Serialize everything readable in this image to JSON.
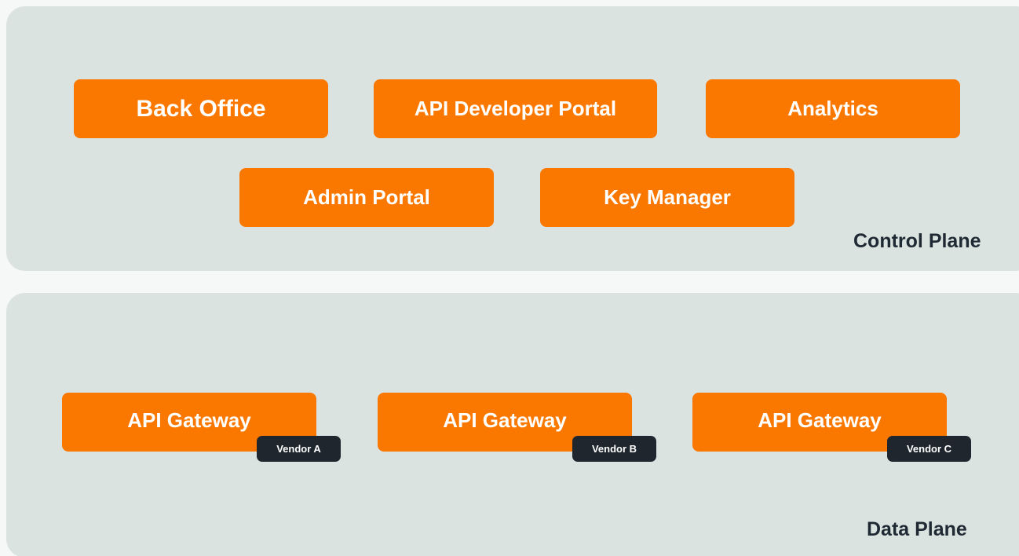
{
  "control_plane": {
    "label": "Control Plane",
    "components": {
      "back_office": "Back Office",
      "api_developer_portal": "API Developer Portal",
      "analytics": "Analytics",
      "admin_portal": "Admin Portal",
      "key_manager": "Key Manager"
    }
  },
  "data_plane": {
    "label": "Data Plane",
    "gateways": [
      {
        "label": "API Gateway",
        "vendor": "Vendor A"
      },
      {
        "label": "API Gateway",
        "vendor": "Vendor B"
      },
      {
        "label": "API Gateway",
        "vendor": "Vendor C"
      }
    ]
  },
  "colors": {
    "plane_background": "#dbe3e0",
    "component_fill": "#fa7800",
    "vendor_badge_fill": "#1f262e",
    "label_text": "#1f2933"
  }
}
